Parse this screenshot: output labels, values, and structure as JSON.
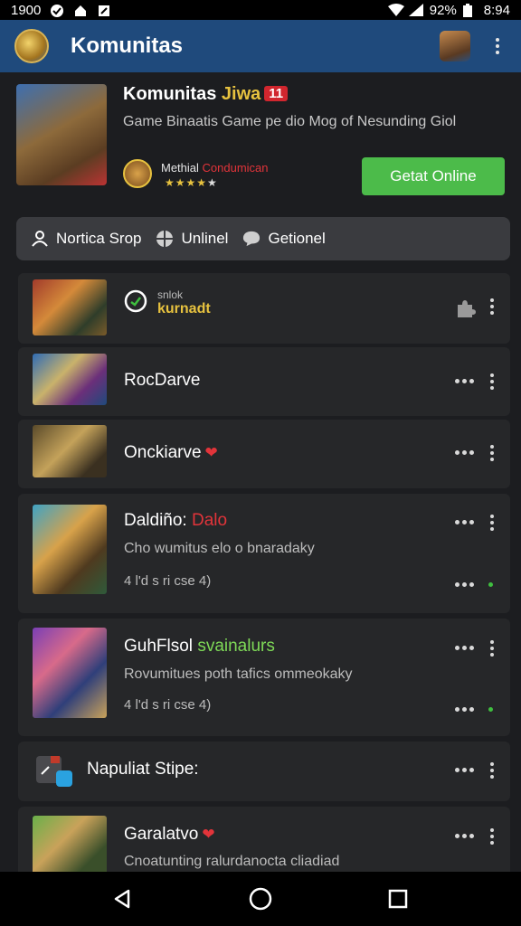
{
  "status_bar": {
    "time_left": "1900",
    "battery_pct": "92%",
    "time_right": "8:94"
  },
  "app_bar": {
    "title": "Komunitas"
  },
  "hero": {
    "title": "Komunitas ",
    "title_accent": "Jiwa",
    "badge": "11",
    "description": "Game Binaatis Game pe dio Mog of Nesunding Giol",
    "developer_name": "Methial ",
    "developer_accent": "Condumican",
    "stars_filled": "★★★★",
    "stars_empty": "★",
    "rating": 4,
    "cta_label": "Getat Online"
  },
  "filters": [
    {
      "label": "Nortica Srop",
      "icon": "person-icon"
    },
    {
      "label": "Unlinel",
      "icon": "globe-icon"
    },
    {
      "label": "Getionel",
      "icon": "chat-icon"
    }
  ],
  "list": [
    {
      "tag": "snlok",
      "title": "kurnadt"
    },
    {
      "title": "RocDarve"
    },
    {
      "title": "Onckiarve",
      "heart": "❤"
    },
    {
      "title": "Daldiño: ",
      "title_accent": "Dalo",
      "subtitle": "Cho wumitus elo o bnaradaky",
      "meta": "4 l'd s ri cse 4)"
    },
    {
      "title": "GuhFlsol ",
      "title_accent": "svainalurs",
      "subtitle": "Rovumitues poth tafics ommeokaky",
      "meta": "4 l'd s ri cse 4)"
    },
    {
      "title": "Napuliat Stipe:"
    },
    {
      "title": "Garalatvo",
      "heart": "❤",
      "subtitle": "Cnoatunting ralurdanocta cliadiad"
    }
  ],
  "colors": {
    "app_bar": "#1f4a7c",
    "cta": "#4cbb4a",
    "accent_red": "#e2343a",
    "accent_gold": "#e7c23f"
  }
}
